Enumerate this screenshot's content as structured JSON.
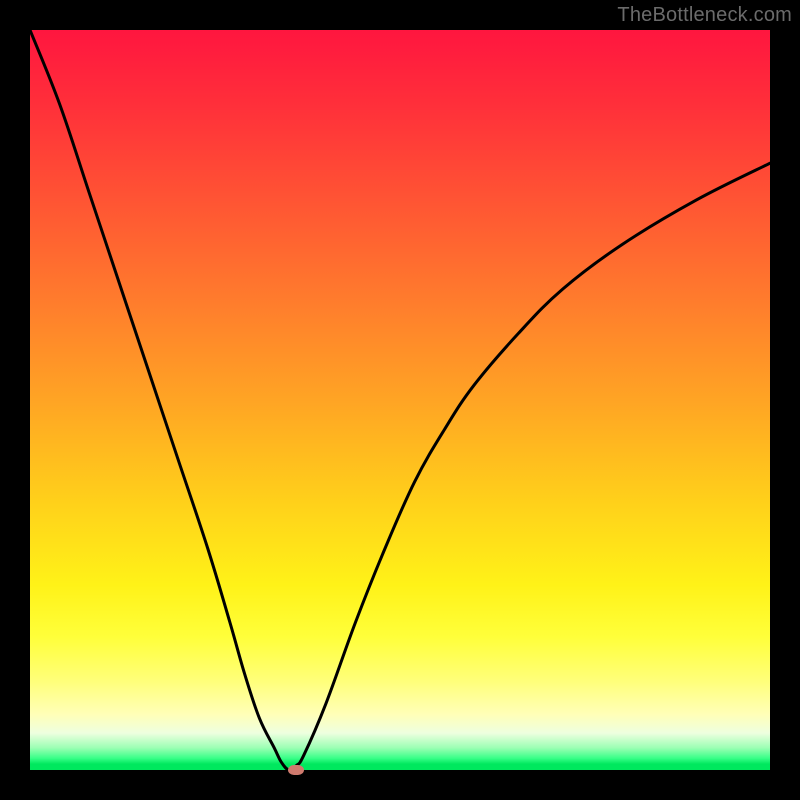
{
  "watermark": "TheBottleneck.com",
  "colors": {
    "frame": "#000000",
    "curve": "#000000",
    "marker": "#cf7a6e"
  },
  "chart_data": {
    "type": "line",
    "title": "",
    "xlabel": "",
    "ylabel": "",
    "xlim": [
      0,
      100
    ],
    "ylim": [
      0,
      100
    ],
    "grid": false,
    "series": [
      {
        "name": "bottleneck-curve",
        "x": [
          0,
          4,
          8,
          12,
          16,
          20,
          24,
          27,
          29,
          31,
          33,
          34,
          35,
          36,
          37,
          40,
          44,
          48,
          52,
          56,
          60,
          66,
          72,
          80,
          90,
          100
        ],
        "values": [
          100,
          90,
          78,
          66,
          54,
          42,
          30,
          20,
          13,
          7,
          3,
          1,
          0,
          0.6,
          2,
          9,
          20,
          30,
          39,
          46,
          52,
          59,
          65,
          71,
          77,
          82
        ]
      }
    ],
    "marker": {
      "x": 36,
      "y": 0
    },
    "background_gradient_top_to_bottom": [
      {
        "pct": 0,
        "color": "#ff163f"
      },
      {
        "pct": 50,
        "color": "#ffa424"
      },
      {
        "pct": 82,
        "color": "#ffff3a"
      },
      {
        "pct": 95,
        "color": "#eeffdf"
      },
      {
        "pct": 100,
        "color": "#00e85e"
      }
    ]
  }
}
